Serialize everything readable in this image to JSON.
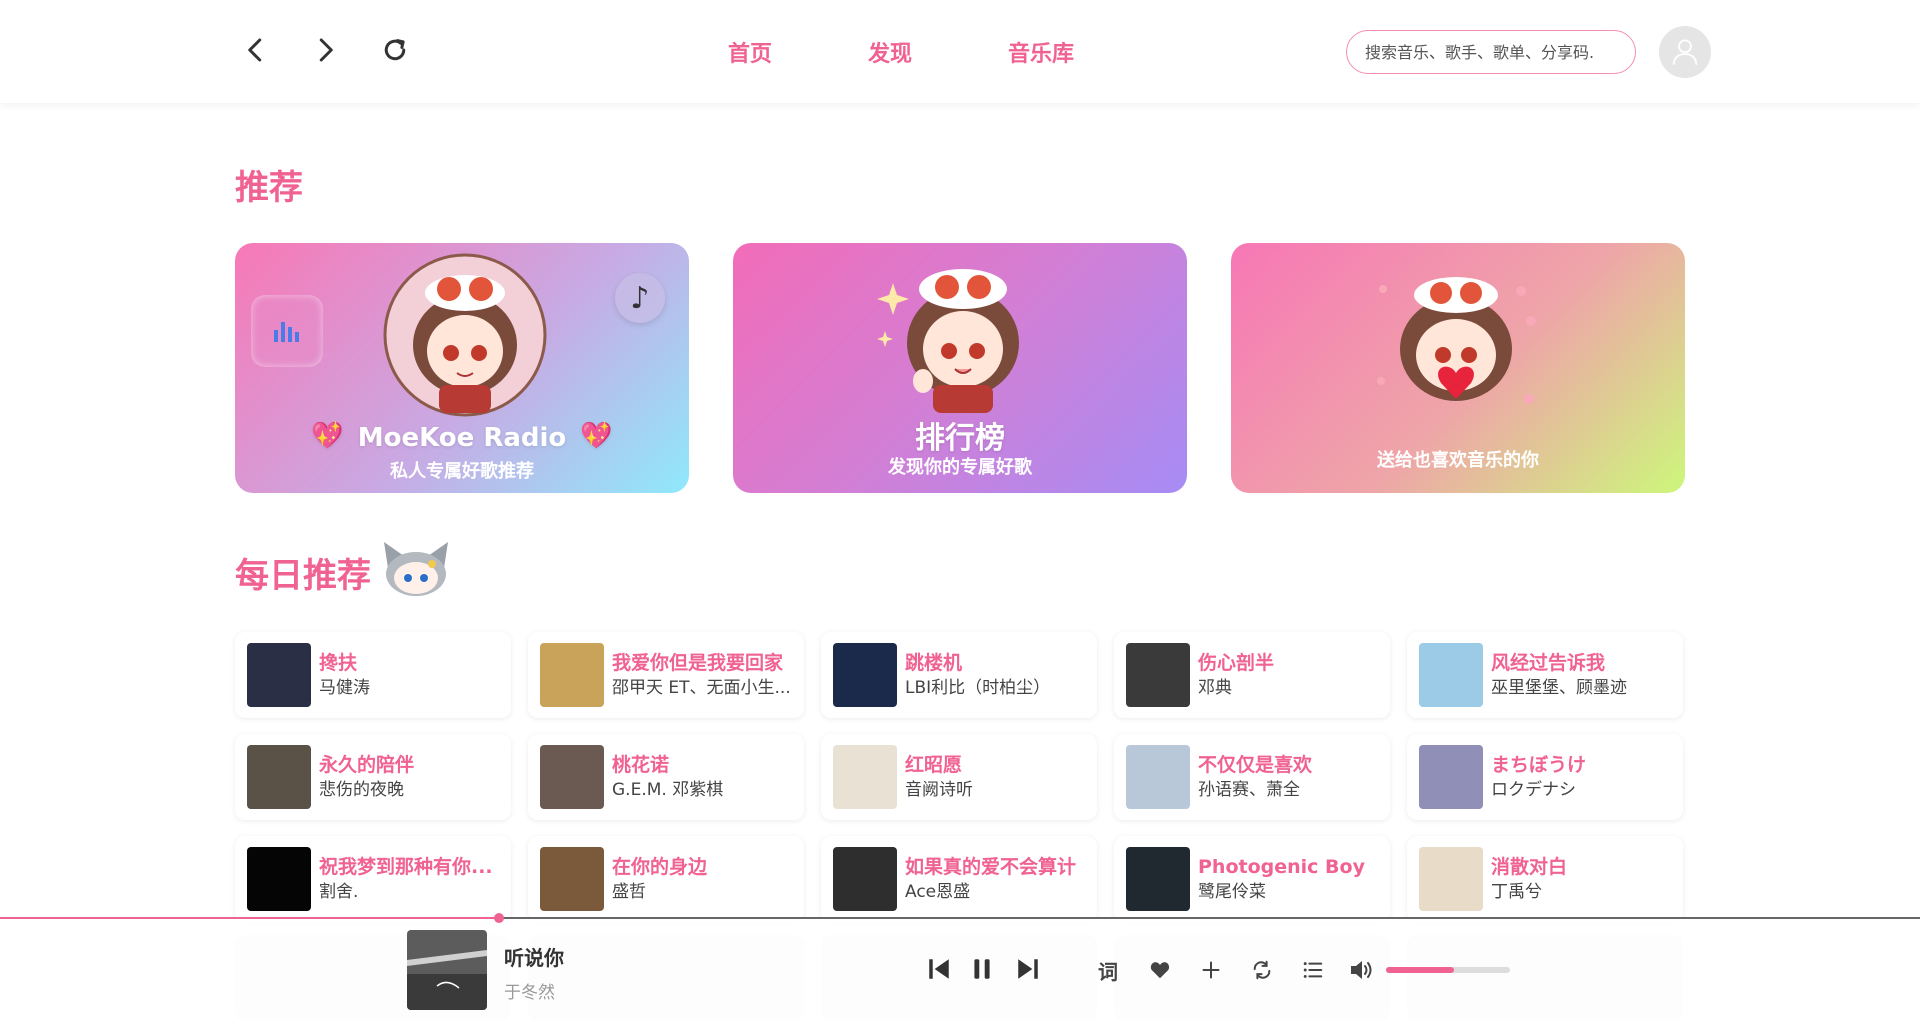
{
  "window_controls": {
    "minimize_color": "#fdbc2f",
    "maximize_color": "#29c840",
    "close_color": "#ff5f57"
  },
  "nav": {
    "back_icon": "chevron-left-icon",
    "forward_icon": "chevron-right-icon",
    "refresh_icon": "refresh-icon"
  },
  "tabs": [
    {
      "label": "首页"
    },
    {
      "label": "发现"
    },
    {
      "label": "音乐库"
    }
  ],
  "search": {
    "placeholder": "搜索音乐、歌手、歌单、分享码."
  },
  "accent_color": "#f06292",
  "sections": {
    "recommend_title": "推荐",
    "daily_title": "每日推荐"
  },
  "features": [
    {
      "title": "MoeKoe Radio",
      "subtitle": "私人专属好歌推荐"
    },
    {
      "title": "排行榜",
      "subtitle": "发现你的专属好歌"
    },
    {
      "title": "",
      "subtitle": "送给也喜欢音乐的你"
    }
  ],
  "songs": [
    {
      "title": "搀扶",
      "artist": "马健涛",
      "cover": "#2a2f45"
    },
    {
      "title": "我爱你但是我要回家",
      "artist": "邵甲天 ET、无面小生...",
      "cover": "#c9a35a"
    },
    {
      "title": "跳楼机",
      "artist": "LBI利比（时柏尘）",
      "cover": "#1b2a4a"
    },
    {
      "title": "伤心剖半",
      "artist": "邓典",
      "cover": "#3a3a3a"
    },
    {
      "title": "风经过告诉我",
      "artist": "巫里堡堡、顾墨迹",
      "cover": "#9ccbe8"
    },
    {
      "title": "永久的陪伴",
      "artist": "悲伤的夜晚",
      "cover": "#5a5246"
    },
    {
      "title": "桃花诺",
      "artist": "G.E.M. 邓紫棋",
      "cover": "#6a5a52"
    },
    {
      "title": "红昭愿",
      "artist": "音阙诗听",
      "cover": "#e9e2d4"
    },
    {
      "title": "不仅仅是喜欢",
      "artist": "孙语赛、萧全",
      "cover": "#b8c8d8"
    },
    {
      "title": "まちぼうけ",
      "artist": "ロクデナシ",
      "cover": "#8f8fb8"
    },
    {
      "title": "祝我梦到那种有你...",
      "artist": "割舍.",
      "cover": "#050505"
    },
    {
      "title": "在你的身边",
      "artist": "盛哲",
      "cover": "#7a5a3a"
    },
    {
      "title": "如果真的爱不会算计",
      "artist": "Ace恩盛",
      "cover": "#2e2e2e"
    },
    {
      "title": "Photogenic Boy",
      "artist": "鹭尾伶菜",
      "cover": "#202830"
    },
    {
      "title": "消散对白",
      "artist": "丁禹兮",
      "cover": "#e8dcc8"
    }
  ],
  "player": {
    "title": "听说你",
    "artist": "于冬然",
    "progress": 0.26,
    "volume": 0.55,
    "lyrics_label": "词"
  }
}
